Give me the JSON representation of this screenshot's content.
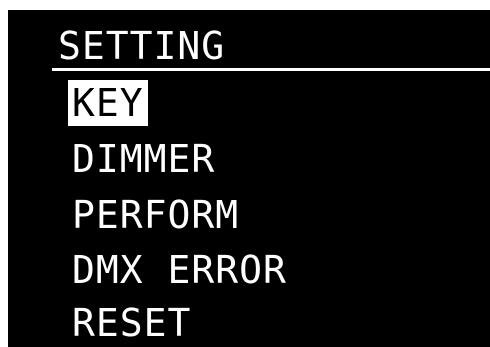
{
  "screen": {
    "title": "SETTING",
    "menu": [
      {
        "label": "KEY",
        "selected": true
      },
      {
        "label": "DIMMER",
        "selected": false
      },
      {
        "label": "PERFORM",
        "selected": false
      },
      {
        "label": "DMX ERROR",
        "selected": false
      },
      {
        "label": "RESET",
        "selected": false
      }
    ]
  },
  "colors": {
    "background": "#000000",
    "foreground": "#ffffff",
    "highlight": "#ffffff"
  }
}
